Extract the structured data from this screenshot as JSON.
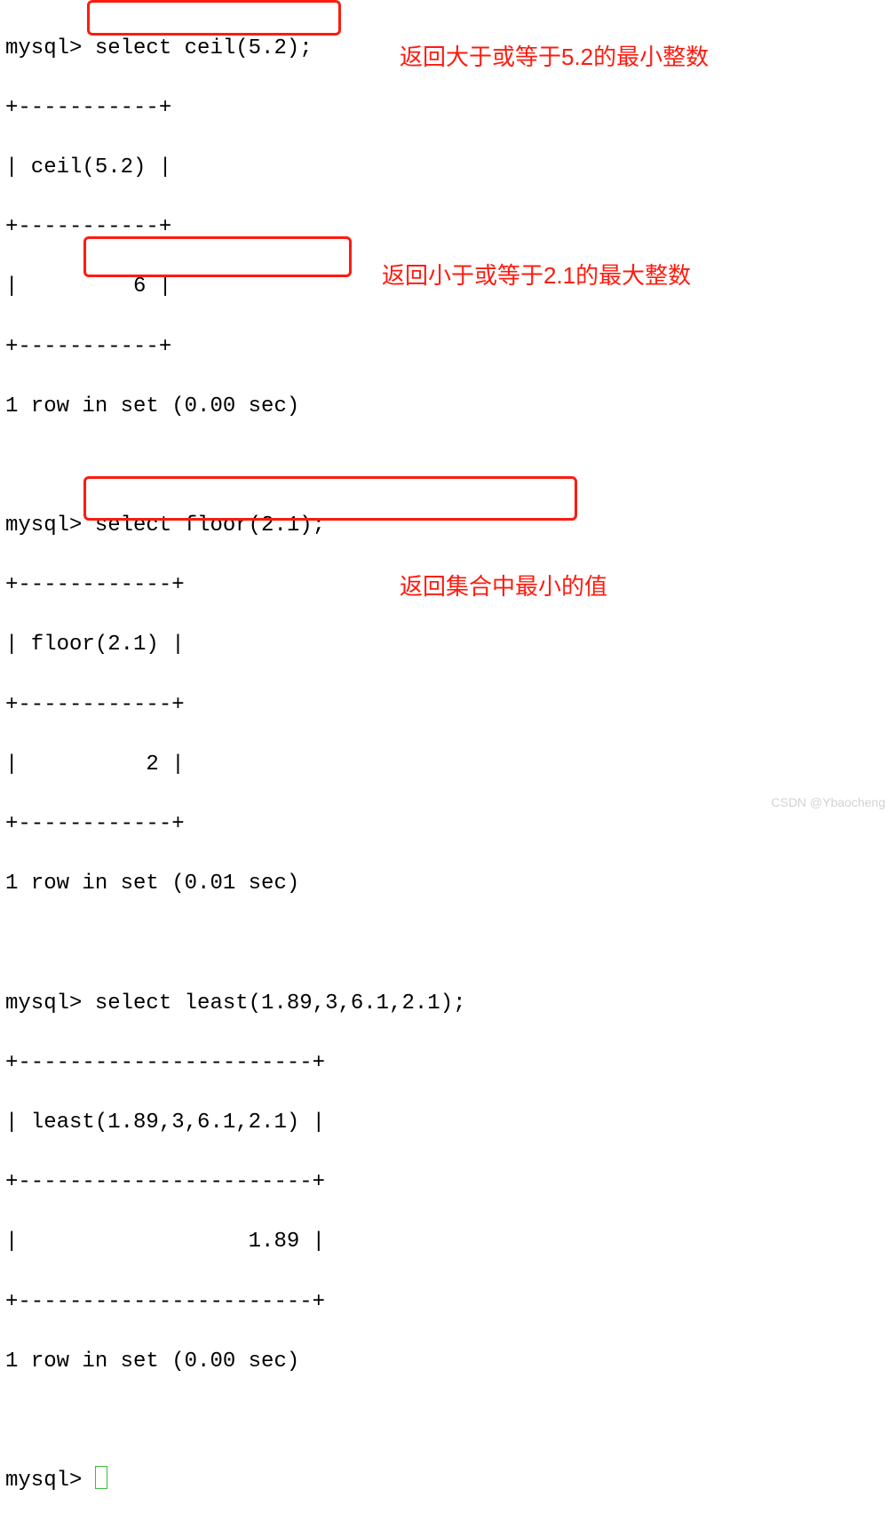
{
  "prompt": "mysql>",
  "q1": {
    "cmd": " select ceil(5.2);",
    "border": "+-----------+",
    "header": "| ceil(5.2) |",
    "row": "|         6 |",
    "status": "1 row in set (0.00 sec)",
    "annot": "返回大于或等于5.2的最小整数"
  },
  "q2": {
    "cmd": " select floor(2.1);",
    "border": "+------------+",
    "header": "| floor(2.1) |",
    "row": "|          2 |",
    "status": "1 row in set (0.01 sec)",
    "annot": "返回小于或等于2.1的最大整数"
  },
  "q3": {
    "cmd": " select least(1.89,3,6.1,2.1);",
    "border": "+-----------------------+",
    "header": "| least(1.89,3,6.1,2.1) |",
    "row": "|                  1.89 |",
    "status": "1 row in set (0.00 sec)",
    "annot": "返回集合中最小的值"
  },
  "watermark": "CSDN @Ybaocheng"
}
